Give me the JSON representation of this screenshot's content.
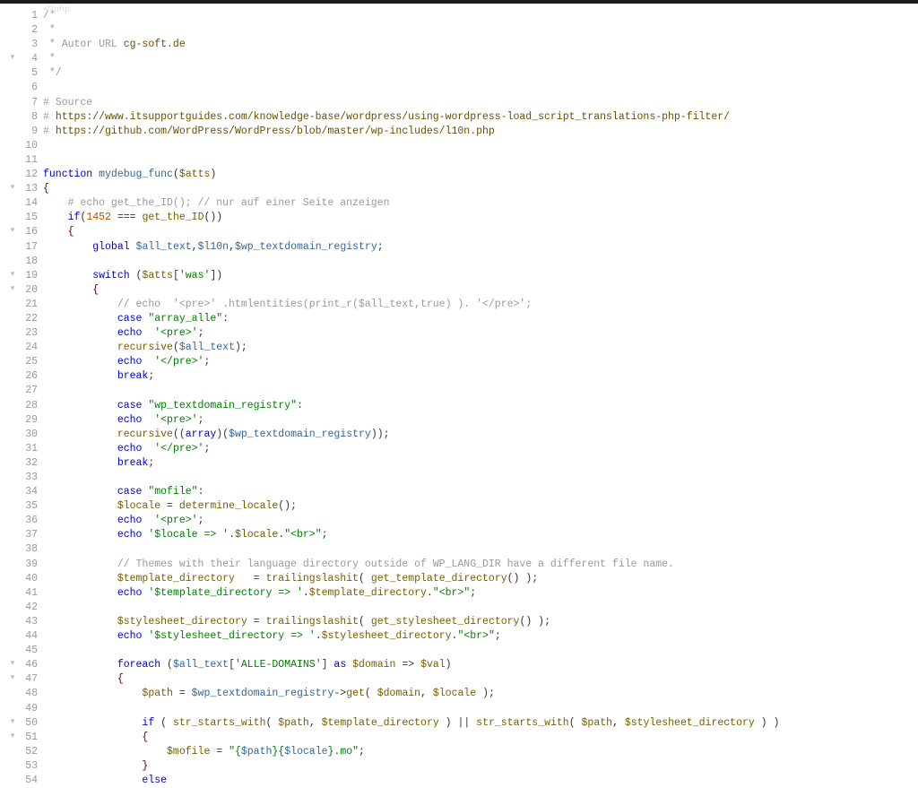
{
  "file": {
    "language": "php",
    "first_line": 1,
    "last_line": 54,
    "folded_top": "<?php"
  },
  "fold_markers": [
    4,
    13,
    16,
    19,
    20,
    46,
    47,
    50,
    51
  ],
  "lines": [
    {
      "n": 1,
      "tokens": [
        {
          "c": "c-docstar",
          "t": "/*"
        }
      ]
    },
    {
      "n": 2,
      "tokens": [
        {
          "c": "c-docstar",
          "t": " *"
        }
      ]
    },
    {
      "n": 3,
      "tokens": [
        {
          "c": "c-docstar",
          "t": " * Autor URL "
        },
        {
          "c": "c-url",
          "t": "cg-soft.de"
        }
      ]
    },
    {
      "n": 4,
      "tokens": [
        {
          "c": "c-docstar",
          "t": " *"
        }
      ]
    },
    {
      "n": 5,
      "tokens": [
        {
          "c": "c-docstar",
          "t": " */"
        }
      ]
    },
    {
      "n": 6,
      "tokens": []
    },
    {
      "n": 7,
      "tokens": [
        {
          "c": "c-comment",
          "t": "# Source"
        }
      ]
    },
    {
      "n": 8,
      "tokens": [
        {
          "c": "c-comment",
          "t": "# "
        },
        {
          "c": "c-url",
          "t": "https://www.itsupportguides.com/knowledge-base/wordpress/using-wordpress-load_script_translations-php-filter/"
        }
      ]
    },
    {
      "n": 9,
      "tokens": [
        {
          "c": "c-comment",
          "t": "# "
        },
        {
          "c": "c-url",
          "t": "https://github.com/WordPress/WordPress/blob/master/wp-includes/l10n.php"
        }
      ]
    },
    {
      "n": 10,
      "tokens": []
    },
    {
      "n": 11,
      "tokens": []
    },
    {
      "n": 12,
      "tokens": [
        {
          "c": "c-keyword",
          "t": "function"
        },
        {
          "c": "",
          "t": " "
        },
        {
          "c": "c-funcdef",
          "t": "mydebug_func"
        },
        {
          "c": "c-punct",
          "t": "("
        },
        {
          "c": "c-var",
          "t": "$atts"
        },
        {
          "c": "c-punct",
          "t": ")"
        }
      ]
    },
    {
      "n": 13,
      "tokens": [
        {
          "c": "c-brace",
          "t": "{"
        }
      ]
    },
    {
      "n": 14,
      "indent": 1,
      "tokens": [
        {
          "c": "c-comment",
          "t": "# echo get_the_ID(); // nur auf einer Seite anzeigen"
        }
      ]
    },
    {
      "n": 15,
      "indent": 1,
      "tokens": [
        {
          "c": "c-keyword",
          "t": "if"
        },
        {
          "c": "c-punct",
          "t": "("
        },
        {
          "c": "c-num",
          "t": "1452"
        },
        {
          "c": "",
          "t": " === "
        },
        {
          "c": "c-func",
          "t": "get_the_ID"
        },
        {
          "c": "c-punct",
          "t": "())"
        }
      ]
    },
    {
      "n": 16,
      "indent": 1,
      "tokens": [
        {
          "c": "c-brace",
          "t": "{"
        }
      ]
    },
    {
      "n": 17,
      "indent": 2,
      "tokens": [
        {
          "c": "c-keyword",
          "t": "global"
        },
        {
          "c": "",
          "t": " "
        },
        {
          "c": "c-bluevar",
          "t": "$all_text"
        },
        {
          "c": "c-punct",
          "t": ","
        },
        {
          "c": "c-bluevar",
          "t": "$l10n"
        },
        {
          "c": "c-punct",
          "t": ","
        },
        {
          "c": "c-bluevar",
          "t": "$wp_textdomain_registry"
        },
        {
          "c": "c-punct",
          "t": ";"
        }
      ]
    },
    {
      "n": 18,
      "tokens": []
    },
    {
      "n": 19,
      "indent": 2,
      "tokens": [
        {
          "c": "c-keyword",
          "t": "switch"
        },
        {
          "c": "",
          "t": " ("
        },
        {
          "c": "c-var",
          "t": "$atts"
        },
        {
          "c": "c-punct",
          "t": "["
        },
        {
          "c": "c-string",
          "t": "'was'"
        },
        {
          "c": "c-punct",
          "t": "])"
        }
      ]
    },
    {
      "n": 20,
      "indent": 2,
      "tokens": [
        {
          "c": "c-brace",
          "t": "{"
        }
      ]
    },
    {
      "n": 21,
      "indent": 3,
      "tokens": [
        {
          "c": "c-comment",
          "t": "// echo  '<pre>' .htmlentities(print_r($all_text,true) ). '</pre>';"
        }
      ]
    },
    {
      "n": 22,
      "indent": 3,
      "tokens": [
        {
          "c": "c-keyword",
          "t": "case"
        },
        {
          "c": "",
          "t": " "
        },
        {
          "c": "c-string",
          "t": "\"array_alle\""
        },
        {
          "c": "c-punct",
          "t": ":"
        }
      ]
    },
    {
      "n": 23,
      "indent": 3,
      "tokens": [
        {
          "c": "c-keyword",
          "t": "echo"
        },
        {
          "c": "",
          "t": "  "
        },
        {
          "c": "c-string",
          "t": "'<pre>'"
        },
        {
          "c": "c-punct",
          "t": ";"
        }
      ]
    },
    {
      "n": 24,
      "indent": 3,
      "tokens": [
        {
          "c": "c-func",
          "t": "recursive"
        },
        {
          "c": "c-punct",
          "t": "("
        },
        {
          "c": "c-bluevar",
          "t": "$all_text"
        },
        {
          "c": "c-punct",
          "t": ");"
        }
      ]
    },
    {
      "n": 25,
      "indent": 3,
      "tokens": [
        {
          "c": "c-keyword",
          "t": "echo"
        },
        {
          "c": "",
          "t": "  "
        },
        {
          "c": "c-string",
          "t": "'</pre>'"
        },
        {
          "c": "c-punct",
          "t": ";"
        }
      ]
    },
    {
      "n": 26,
      "indent": 3,
      "tokens": [
        {
          "c": "c-keyword",
          "t": "break"
        },
        {
          "c": "c-punct",
          "t": ";"
        }
      ]
    },
    {
      "n": 27,
      "tokens": []
    },
    {
      "n": 28,
      "indent": 3,
      "tokens": [
        {
          "c": "c-keyword",
          "t": "case"
        },
        {
          "c": "",
          "t": " "
        },
        {
          "c": "c-string",
          "t": "\"wp_textdomain_registry\""
        },
        {
          "c": "c-punct",
          "t": ":"
        }
      ]
    },
    {
      "n": 29,
      "indent": 3,
      "tokens": [
        {
          "c": "c-keyword",
          "t": "echo"
        },
        {
          "c": "",
          "t": "  "
        },
        {
          "c": "c-string",
          "t": "'<pre>'"
        },
        {
          "c": "c-punct",
          "t": ";"
        }
      ]
    },
    {
      "n": 30,
      "indent": 3,
      "tokens": [
        {
          "c": "c-func",
          "t": "recursive"
        },
        {
          "c": "c-punct",
          "t": "(("
        },
        {
          "c": "c-keyword",
          "t": "array"
        },
        {
          "c": "c-punct",
          "t": ")("
        },
        {
          "c": "c-bluevar",
          "t": "$wp_textdomain_registry"
        },
        {
          "c": "c-punct",
          "t": "));"
        }
      ]
    },
    {
      "n": 31,
      "indent": 3,
      "tokens": [
        {
          "c": "c-keyword",
          "t": "echo"
        },
        {
          "c": "",
          "t": "  "
        },
        {
          "c": "c-string",
          "t": "'</pre>'"
        },
        {
          "c": "c-punct",
          "t": ";"
        }
      ]
    },
    {
      "n": 32,
      "indent": 3,
      "tokens": [
        {
          "c": "c-keyword",
          "t": "break"
        },
        {
          "c": "c-punct",
          "t": ";"
        }
      ]
    },
    {
      "n": 33,
      "tokens": []
    },
    {
      "n": 34,
      "indent": 3,
      "tokens": [
        {
          "c": "c-keyword",
          "t": "case"
        },
        {
          "c": "",
          "t": " "
        },
        {
          "c": "c-string",
          "t": "\"mofile\""
        },
        {
          "c": "c-punct",
          "t": ":"
        }
      ]
    },
    {
      "n": 35,
      "indent": 3,
      "tokens": [
        {
          "c": "c-var",
          "t": "$locale"
        },
        {
          "c": "",
          "t": " = "
        },
        {
          "c": "c-func",
          "t": "determine_locale"
        },
        {
          "c": "c-punct",
          "t": "();"
        }
      ]
    },
    {
      "n": 36,
      "indent": 3,
      "tokens": [
        {
          "c": "c-keyword",
          "t": "echo"
        },
        {
          "c": "",
          "t": "  "
        },
        {
          "c": "c-string",
          "t": "'<pre>'"
        },
        {
          "c": "c-punct",
          "t": ";"
        }
      ]
    },
    {
      "n": 37,
      "indent": 3,
      "tokens": [
        {
          "c": "c-keyword",
          "t": "echo"
        },
        {
          "c": "",
          "t": " "
        },
        {
          "c": "c-string",
          "t": "'$locale => '"
        },
        {
          "c": "c-punct",
          "t": "."
        },
        {
          "c": "c-var",
          "t": "$locale"
        },
        {
          "c": "c-punct",
          "t": "."
        },
        {
          "c": "c-string",
          "t": "\"<br>\""
        },
        {
          "c": "c-punct",
          "t": ";"
        }
      ]
    },
    {
      "n": 38,
      "tokens": []
    },
    {
      "n": 39,
      "indent": 3,
      "tokens": [
        {
          "c": "c-comment",
          "t": "// Themes with their language directory outside of WP_LANG_DIR have a different file name."
        }
      ]
    },
    {
      "n": 40,
      "indent": 3,
      "tokens": [
        {
          "c": "c-var",
          "t": "$template_directory"
        },
        {
          "c": "",
          "t": "   = "
        },
        {
          "c": "c-func",
          "t": "trailingslashit"
        },
        {
          "c": "c-punct",
          "t": "( "
        },
        {
          "c": "c-func",
          "t": "get_template_directory"
        },
        {
          "c": "c-punct",
          "t": "() );"
        }
      ]
    },
    {
      "n": 41,
      "indent": 3,
      "tokens": [
        {
          "c": "c-keyword",
          "t": "echo"
        },
        {
          "c": "",
          "t": " "
        },
        {
          "c": "c-string",
          "t": "'$template_directory => '"
        },
        {
          "c": "c-punct",
          "t": "."
        },
        {
          "c": "c-var",
          "t": "$template_directory"
        },
        {
          "c": "c-punct",
          "t": "."
        },
        {
          "c": "c-string",
          "t": "\"<br>\""
        },
        {
          "c": "c-punct",
          "t": ";"
        }
      ]
    },
    {
      "n": 42,
      "tokens": []
    },
    {
      "n": 43,
      "indent": 3,
      "tokens": [
        {
          "c": "c-var",
          "t": "$stylesheet_directory"
        },
        {
          "c": "",
          "t": " = "
        },
        {
          "c": "c-func",
          "t": "trailingslashit"
        },
        {
          "c": "c-punct",
          "t": "( "
        },
        {
          "c": "c-func",
          "t": "get_stylesheet_directory"
        },
        {
          "c": "c-punct",
          "t": "() );"
        }
      ]
    },
    {
      "n": 44,
      "indent": 3,
      "tokens": [
        {
          "c": "c-keyword",
          "t": "echo"
        },
        {
          "c": "",
          "t": " "
        },
        {
          "c": "c-string",
          "t": "'$stylesheet_directory => '"
        },
        {
          "c": "c-punct",
          "t": "."
        },
        {
          "c": "c-var",
          "t": "$stylesheet_directory"
        },
        {
          "c": "c-punct",
          "t": "."
        },
        {
          "c": "c-string",
          "t": "\"<br>\""
        },
        {
          "c": "c-punct",
          "t": ";"
        }
      ]
    },
    {
      "n": 45,
      "tokens": []
    },
    {
      "n": 46,
      "indent": 3,
      "tokens": [
        {
          "c": "c-keyword",
          "t": "foreach"
        },
        {
          "c": "",
          "t": " ("
        },
        {
          "c": "c-bluevar",
          "t": "$all_text"
        },
        {
          "c": "c-punct",
          "t": "["
        },
        {
          "c": "c-string",
          "t": "'ALLE-DOMAINS'"
        },
        {
          "c": "c-punct",
          "t": "] "
        },
        {
          "c": "c-keyword",
          "t": "as"
        },
        {
          "c": "",
          "t": " "
        },
        {
          "c": "c-var",
          "t": "$domain"
        },
        {
          "c": "",
          "t": " => "
        },
        {
          "c": "c-var",
          "t": "$val"
        },
        {
          "c": "c-punct",
          "t": ")"
        }
      ]
    },
    {
      "n": 47,
      "indent": 3,
      "tokens": [
        {
          "c": "c-brace",
          "t": "{"
        }
      ]
    },
    {
      "n": 48,
      "indent": 4,
      "tokens": [
        {
          "c": "c-var",
          "t": "$path"
        },
        {
          "c": "",
          "t": " = "
        },
        {
          "c": "c-bluevar",
          "t": "$wp_textdomain_registry"
        },
        {
          "c": "c-arrow",
          "t": "->"
        },
        {
          "c": "c-func",
          "t": "get"
        },
        {
          "c": "c-punct",
          "t": "( "
        },
        {
          "c": "c-var",
          "t": "$domain"
        },
        {
          "c": "c-punct",
          "t": ", "
        },
        {
          "c": "c-var",
          "t": "$locale"
        },
        {
          "c": "c-punct",
          "t": " );"
        }
      ]
    },
    {
      "n": 49,
      "tokens": []
    },
    {
      "n": 50,
      "indent": 4,
      "tokens": [
        {
          "c": "c-keyword",
          "t": "if"
        },
        {
          "c": "",
          "t": " ( "
        },
        {
          "c": "c-func",
          "t": "str_starts_with"
        },
        {
          "c": "c-punct",
          "t": "( "
        },
        {
          "c": "c-var",
          "t": "$path"
        },
        {
          "c": "c-punct",
          "t": ", "
        },
        {
          "c": "c-var",
          "t": "$template_directory"
        },
        {
          "c": "c-punct",
          "t": " ) || "
        },
        {
          "c": "c-func",
          "t": "str_starts_with"
        },
        {
          "c": "c-punct",
          "t": "( "
        },
        {
          "c": "c-var",
          "t": "$path"
        },
        {
          "c": "c-punct",
          "t": ", "
        },
        {
          "c": "c-var",
          "t": "$stylesheet_directory"
        },
        {
          "c": "c-punct",
          "t": " ) )"
        }
      ]
    },
    {
      "n": 51,
      "indent": 4,
      "tokens": [
        {
          "c": "c-brace",
          "t": "{"
        }
      ]
    },
    {
      "n": 52,
      "indent": 5,
      "tokens": [
        {
          "c": "c-var",
          "t": "$mofile"
        },
        {
          "c": "",
          "t": " = "
        },
        {
          "c": "c-string",
          "t": "\"{"
        },
        {
          "c": "c-bluevar",
          "t": "$path"
        },
        {
          "c": "c-string",
          "t": "}{"
        },
        {
          "c": "c-bluevar",
          "t": "$locale"
        },
        {
          "c": "c-string",
          "t": "}.mo\""
        },
        {
          "c": "c-punct",
          "t": ";"
        }
      ]
    },
    {
      "n": 53,
      "indent": 4,
      "tokens": [
        {
          "c": "c-brace",
          "t": "}"
        }
      ]
    },
    {
      "n": 54,
      "indent": 4,
      "tokens": [
        {
          "c": "c-keyword",
          "t": "else"
        }
      ]
    }
  ]
}
